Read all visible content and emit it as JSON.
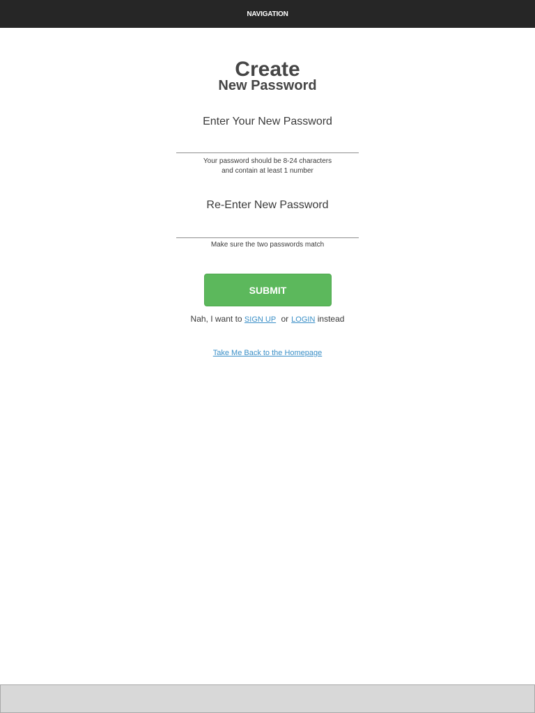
{
  "nav": {
    "title": "NAVIGATION"
  },
  "header": {
    "title": "Create",
    "subtitle": "New Password"
  },
  "form": {
    "new_password": {
      "label": "Enter Your New Password",
      "value": "",
      "hint_line1": "Your password should be 8-24 characters",
      "hint_line2": "and contain at least 1 number"
    },
    "reenter_password": {
      "label": "Re-Enter New Password",
      "value": "",
      "hint": "Make sure the two passwords match"
    },
    "submit_label": "SUBMIT"
  },
  "alternate": {
    "prefix": "Nah, I want to",
    "signup_label": "SIGN UP",
    "or_text": "or",
    "login_label": "LOGIN",
    "suffix": "instead"
  },
  "home_link_label": "Take Me Back to the Homepage",
  "colors": {
    "nav_bg": "#262626",
    "accent_green": "#5cb85c",
    "link_blue": "#3a8fc7",
    "footer_bg": "#d8d8d8"
  }
}
